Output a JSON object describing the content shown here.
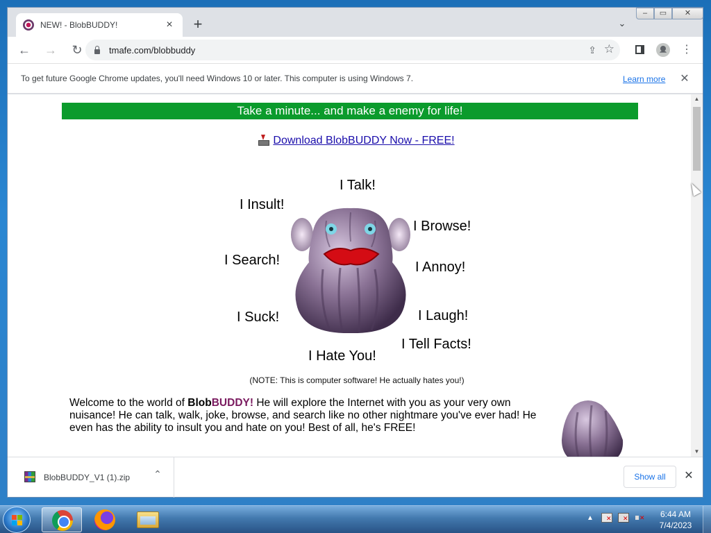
{
  "browser": {
    "tab": {
      "title": "NEW! - BlobBUDDY!",
      "close_icon": "×"
    },
    "new_tab_icon": "+",
    "tab_search_icon": "⌄",
    "window_controls": {
      "minimize": "–",
      "maximize": "▭",
      "close": "✕"
    },
    "nav": {
      "back": "←",
      "forward": "→",
      "reload": "↻"
    },
    "address": {
      "url": "tmafe.com/blobbuddy"
    },
    "share_icon": "⇪",
    "star_icon": "☆",
    "menu_icon": "⋮"
  },
  "infobar": {
    "message": "To get future Google Chrome updates, you'll need Windows 10 or later. This computer is using Windows 7.",
    "learn_more": "Learn more",
    "close": "✕"
  },
  "page": {
    "banner": "Take a minute... and make a enemy for life!",
    "download_link": "Download BlobBUDDY Now - FREE!",
    "words": {
      "talk": "I Talk!",
      "insult": "I Insult!",
      "browse": "I Browse!",
      "search": "I Search!",
      "annoy": "I Annoy!",
      "suck": "I Suck!",
      "laugh": "I Laugh!",
      "facts": "I Tell Facts!",
      "hate": "I Hate You!"
    },
    "note": "(NOTE: This is computer software! He actually hates you!)",
    "welcome": {
      "prefix": "Welcome to the world of ",
      "brand_blob": "Blob",
      "brand_buddy": "BUDDY!",
      "body": " He will explore the Internet with you as your very own nuisance!  He can talk, walk, joke, browse, and search like no other nightmare you've ever had!  He even has the ability to insult you and hate on you! Best of all, he's FREE!"
    }
  },
  "download_bar": {
    "file_name": "BlobBUDDY_V1 (1).zip",
    "chevron": "⌃",
    "show_all": "Show all",
    "close": "✕"
  },
  "taskbar": {
    "time": "6:44 AM",
    "date": "7/4/2023",
    "tray_expand": "▲"
  },
  "colors": {
    "banner_green": "#0b9b2c",
    "link_blue": "#1a0dab",
    "brand_purple": "#7a1a5f",
    "blob_purple": "#8a7295"
  }
}
